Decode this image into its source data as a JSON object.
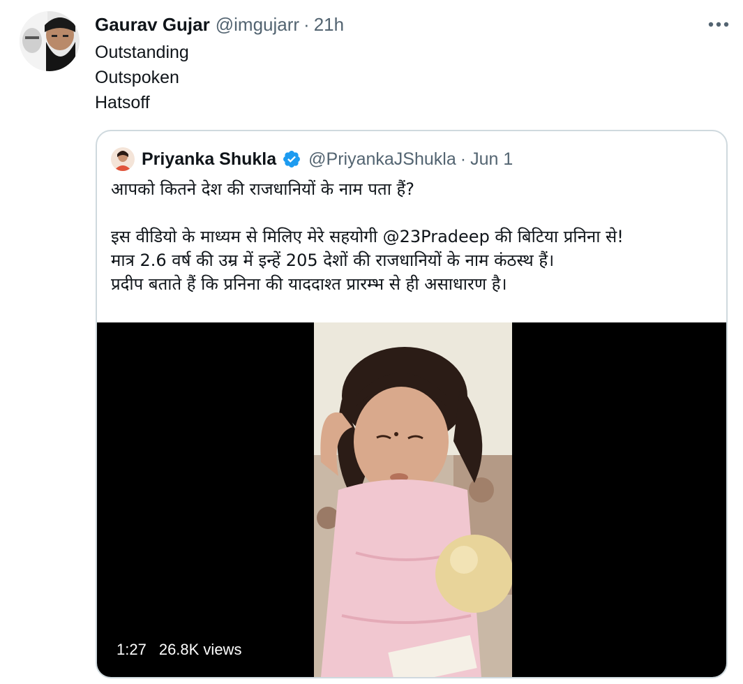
{
  "tweet": {
    "author_name": "Gaurav Gujar",
    "author_handle": "@imgujarr",
    "separator": "·",
    "timestamp": "21h",
    "more_icon": "more-horizontal-icon",
    "lines": [
      "Outstanding",
      "Outspoken",
      "Hatsoff"
    ]
  },
  "quote": {
    "author_name": "Priyanka Shukla",
    "verified_icon": "verified-badge-icon",
    "author_handle": "@PriyankaJShukla",
    "separator": "·",
    "timestamp": "Jun 1",
    "line1": "आपको कितने देश की राजधानियों के नाम पता  हैं?",
    "line2": "इस वीडियो के माध्यम से मिलिए मेरे सहयोगी @23Pradeep की बिटिया प्रनिना से!",
    "line3": "मात्र 2.6 वर्ष की उम्र में इन्हें 205 देशों की राजधानियों के नाम कंठस्थ हैं।",
    "line4": "प्रदीप बताते हैं कि प्रनिना की याददाश्त प्रारम्भ से ही असाधारण है।"
  },
  "video": {
    "duration": "1:27",
    "views": "26.8K views"
  },
  "colors": {
    "text_primary": "#0f1419",
    "text_secondary": "#536471",
    "border": "#cfd9de",
    "verified_blue": "#1d9bf0",
    "video_bg": "#000000"
  }
}
